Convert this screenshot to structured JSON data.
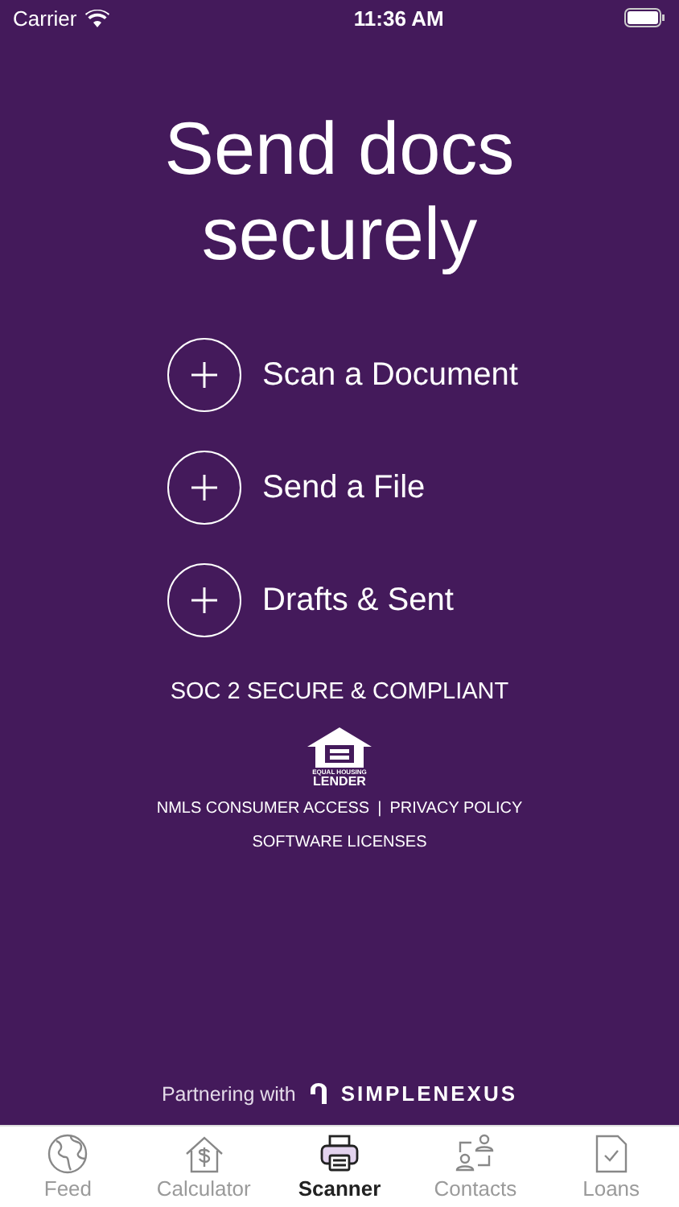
{
  "status_bar": {
    "carrier": "Carrier",
    "time": "11:36 AM"
  },
  "title": "Send docs securely",
  "actions": [
    {
      "label": "Scan a Document"
    },
    {
      "label": "Send a File"
    },
    {
      "label": "Drafts & Sent"
    }
  ],
  "compliance": "SOC 2 SECURE & COMPLIANT",
  "equal_housing": {
    "small": "EQUAL HOUSING",
    "large": "LENDER"
  },
  "links": [
    {
      "label": "NMLS CONSUMER ACCESS"
    },
    {
      "label": "PRIVACY POLICY"
    }
  ],
  "link_separator": "|",
  "software_licenses": "SOFTWARE LICENSES",
  "partner": {
    "prefix": "Partnering with",
    "brand": "SIMPLENEXUS"
  },
  "tabs": [
    {
      "label": "Feed",
      "kind": "globe",
      "selected": false
    },
    {
      "label": "Calculator",
      "kind": "house",
      "selected": false
    },
    {
      "label": "Scanner",
      "kind": "printer",
      "selected": true
    },
    {
      "label": "Contacts",
      "kind": "contacts",
      "selected": false
    },
    {
      "label": "Loans",
      "kind": "document",
      "selected": false
    }
  ]
}
